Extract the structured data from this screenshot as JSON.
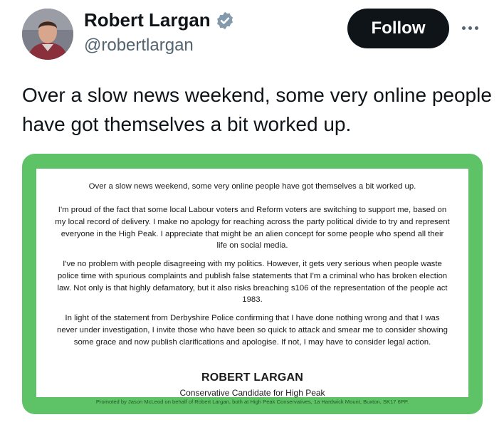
{
  "author": {
    "name": "Robert Largan",
    "handle": "@robertlargan",
    "verified": true,
    "verified_color": "#829aab"
  },
  "actions": {
    "follow_label": "Follow",
    "more_icon": "more-horizontal-icon"
  },
  "tweet": {
    "text": "Over a slow news weekend, some very online people have got themselves a bit worked up."
  },
  "media": {
    "border_color": "#5ec267",
    "paragraphs": [
      "Over a slow news weekend, some very online people have got themselves a bit worked up.",
      "I'm proud of the fact that some local Labour voters and Reform voters are switching to support me, based on my local record of delivery. I make no apology for reaching across the party political divide to try and represent everyone in the High Peak. I appreciate that might be an alien concept for some people who spend all their life on social media.",
      "I've no problem with people disagreeing with my politics. However, it gets very serious when people waste police time with spurious complaints and publish false statements that I'm a criminal who has broken election law. Not only is that highly defamatory, but it also risks breaching s106 of the representation of the people act 1983.",
      "In light of the statement from Derbyshire Police confirming that I have done nothing wrong and that I was never under investigation, I invite those who have been so quick to attack and smear me to consider showing some grace and now publish clarifications and apologise. If not, I may have to consider legal action."
    ],
    "signature_name": "ROBERT LARGAN",
    "signature_title": "Conservative Candidate for High Peak",
    "imprint": "Promoted by Jason McLeod on behalf of Robert Largan, both at High Peak Conservatives, 1a Hardwick Mount, Buxton, SK17 6PP."
  }
}
